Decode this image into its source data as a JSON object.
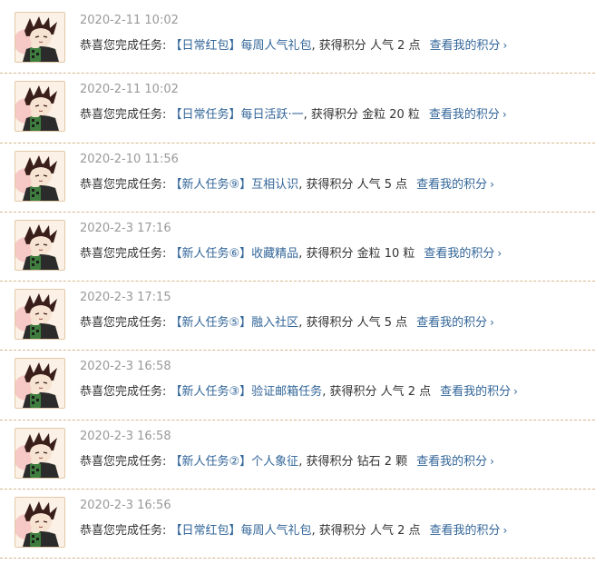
{
  "colors": {
    "link": "#336699",
    "time": "#999999",
    "divider": "#d8b48a",
    "text": "#333333"
  },
  "entries": [
    {
      "time": "2020-2-11 10:02",
      "prefix": "恭喜您完成任务:",
      "task": "【日常红包】每周人气礼包",
      "reward": ", 获得积分 人气 2 点",
      "link": "查看我的积分",
      "chevron": "›",
      "avatar_icon": "anime-avatar-icon"
    },
    {
      "time": "2020-2-11 10:02",
      "prefix": "恭喜您完成任务:",
      "task": "【日常任务】每日活跃·一",
      "reward": ", 获得积分 金粒 20 粒",
      "link": "查看我的积分",
      "chevron": "›",
      "avatar_icon": "anime-avatar-icon"
    },
    {
      "time": "2020-2-10 11:56",
      "prefix": "恭喜您完成任务:",
      "task": "【新人任务⑨】互相认识",
      "reward": ", 获得积分 人气 5 点",
      "link": "查看我的积分",
      "chevron": "›",
      "avatar_icon": "anime-avatar-icon"
    },
    {
      "time": "2020-2-3 17:16",
      "prefix": "恭喜您完成任务:",
      "task": "【新人任务⑥】收藏精品",
      "reward": ", 获得积分 金粒 10 粒",
      "link": "查看我的积分",
      "chevron": "›",
      "avatar_icon": "anime-avatar-icon"
    },
    {
      "time": "2020-2-3 17:15",
      "prefix": "恭喜您完成任务:",
      "task": "【新人任务⑤】融入社区",
      "reward": ", 获得积分 人气 5 点",
      "link": "查看我的积分",
      "chevron": "›",
      "avatar_icon": "anime-avatar-icon"
    },
    {
      "time": "2020-2-3 16:58",
      "prefix": "恭喜您完成任务:",
      "task": "【新人任务③】验证邮箱任务",
      "reward": ", 获得积分 人气 2 点",
      "link": "查看我的积分",
      "chevron": "›",
      "avatar_icon": "anime-avatar-icon"
    },
    {
      "time": "2020-2-3 16:58",
      "prefix": "恭喜您完成任务:",
      "task": "【新人任务②】个人象征",
      "reward": ", 获得积分 钻石 2 颗",
      "link": "查看我的积分",
      "chevron": "›",
      "avatar_icon": "anime-avatar-icon"
    },
    {
      "time": "2020-2-3 16:56",
      "prefix": "恭喜您完成任务:",
      "task": "【日常红包】每周人气礼包",
      "reward": ", 获得积分 人气 2 点",
      "link": "查看我的积分",
      "chevron": "›",
      "avatar_icon": "anime-avatar-icon"
    }
  ]
}
